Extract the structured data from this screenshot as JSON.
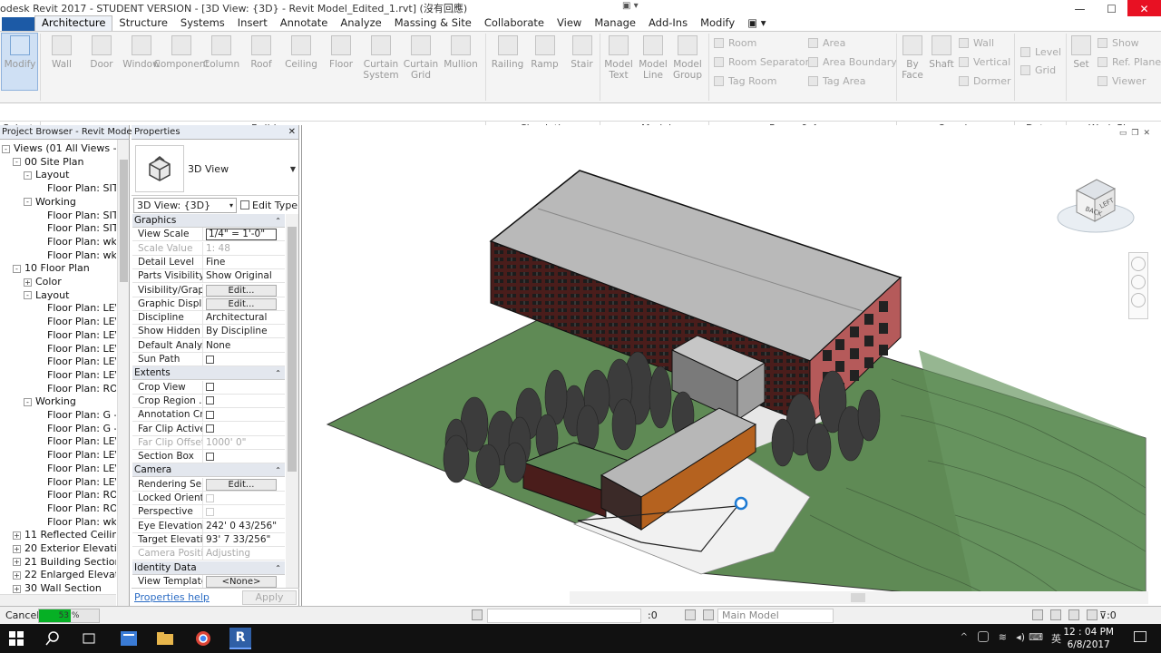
{
  "title": "odesk Revit 2017 - STUDENT VERSION - [3D View: {3D} - Revit Model_Edited_1.rvt] (沒有回應)",
  "tabs": [
    "Architecture",
    "Structure",
    "Systems",
    "Insert",
    "Annotate",
    "Analyze",
    "Massing & Site",
    "Collaborate",
    "View",
    "Manage",
    "Add-Ins",
    "Modify"
  ],
  "ribbon": {
    "modify": "Modify",
    "select": "Select",
    "build_tools": [
      {
        "label": "Wall",
        "icon": "wall-icon"
      },
      {
        "label": "Door",
        "icon": "door-icon"
      },
      {
        "label": "Window",
        "icon": "window-icon"
      },
      {
        "label": "Component",
        "icon": "component-icon"
      },
      {
        "label": "Column",
        "icon": "column-icon"
      },
      {
        "label": "Roof",
        "icon": "roof-icon"
      },
      {
        "label": "Ceiling",
        "icon": "ceiling-icon"
      },
      {
        "label": "Floor",
        "icon": "floor-icon"
      },
      {
        "label": "Curtain System",
        "icon": "curtain-system-icon"
      },
      {
        "label": "Curtain Grid",
        "icon": "curtain-grid-icon"
      },
      {
        "label": "Mullion",
        "icon": "mullion-icon"
      }
    ],
    "circ_tools": [
      {
        "label": "Railing"
      },
      {
        "label": "Ramp"
      },
      {
        "label": "Stair"
      }
    ],
    "model_tools": [
      {
        "label": "Model Text"
      },
      {
        "label": "Model Line"
      },
      {
        "label": "Model Group"
      }
    ],
    "room_small": [
      "Room",
      "Room Separator",
      "Tag Room",
      "Area",
      "Area Boundary",
      "Tag Area"
    ],
    "opening_tools": [
      {
        "label": "By Face"
      },
      {
        "label": "Shaft"
      }
    ],
    "opening_small": [
      "Wall",
      "Vertical",
      "Dormer"
    ],
    "datum_small": [
      "Level",
      "Grid"
    ],
    "wp_tools": [
      {
        "label": "Set"
      }
    ],
    "wp_small": [
      "Show",
      "Ref. Plane",
      "Viewer"
    ],
    "panels": [
      "Build",
      "Circulation",
      "Model",
      "Room & Area",
      "Opening",
      "Datum",
      "Work Plane"
    ]
  },
  "project_browser": {
    "title": "Project Browser - Revit Mode...",
    "items": [
      {
        "label": "Views (01 All Views -",
        "toggle": "-"
      },
      {
        "label": "00 Site Plan",
        "toggle": "-"
      },
      {
        "label": "Layout",
        "toggle": "-"
      },
      {
        "label": "Floor Plan: SITE",
        "toggle": ""
      },
      {
        "label": "Working",
        "toggle": "-"
      },
      {
        "label": "Floor Plan: SITE",
        "toggle": ""
      },
      {
        "label": "Floor Plan: SITE",
        "toggle": ""
      },
      {
        "label": "Floor Plan: wk -",
        "toggle": ""
      },
      {
        "label": "Floor Plan: wk -",
        "toggle": ""
      },
      {
        "label": "10 Floor Plan",
        "toggle": "-"
      },
      {
        "label": "Color",
        "toggle": "+"
      },
      {
        "label": "Layout",
        "toggle": "-"
      },
      {
        "label": "Floor Plan: LEV",
        "toggle": ""
      },
      {
        "label": "Floor Plan: LEV",
        "toggle": ""
      },
      {
        "label": "Floor Plan: LEV",
        "toggle": ""
      },
      {
        "label": "Floor Plan: LEV",
        "toggle": ""
      },
      {
        "label": "Floor Plan: LEV",
        "toggle": ""
      },
      {
        "label": "Floor Plan: LEV",
        "toggle": ""
      },
      {
        "label": "Floor Plan: ROO",
        "toggle": ""
      },
      {
        "label": "Working",
        "toggle": "-"
      },
      {
        "label": "Floor Plan: G -",
        "toggle": ""
      },
      {
        "label": "Floor Plan: G -",
        "toggle": ""
      },
      {
        "label": "Floor Plan: LEV",
        "toggle": ""
      },
      {
        "label": "Floor Plan: LEV",
        "toggle": ""
      },
      {
        "label": "Floor Plan: LEV",
        "toggle": ""
      },
      {
        "label": "Floor Plan: LEV",
        "toggle": ""
      },
      {
        "label": "Floor Plan: ROO",
        "toggle": ""
      },
      {
        "label": "Floor Plan: ROO",
        "toggle": ""
      },
      {
        "label": "Floor Plan: wk -",
        "toggle": ""
      },
      {
        "label": "11 Reflected Ceiling",
        "toggle": "+"
      },
      {
        "label": "20 Exterior Elevation",
        "toggle": "+"
      },
      {
        "label": "21 Building Section",
        "toggle": "+"
      },
      {
        "label": "22 Enlarged Elevation",
        "toggle": "+"
      },
      {
        "label": "30 Wall Section",
        "toggle": "+"
      }
    ]
  },
  "properties": {
    "title": "Properties",
    "type_name": "3D View",
    "instance": "3D View: {3D}",
    "edit_type": "Edit Type",
    "rows": [
      {
        "k": "Graphics",
        "kind": "sec"
      },
      {
        "k": "View Scale",
        "v": "1/4\" = 1'-0\"",
        "kind": "input"
      },
      {
        "k": "Scale Value",
        "v": "1:    48",
        "kind": "dim"
      },
      {
        "k": "Detail Level",
        "v": "Fine"
      },
      {
        "k": "Parts Visibility",
        "v": "Show Original"
      },
      {
        "k": "Visibility/Grap...",
        "v": "Edit...",
        "kind": "btn"
      },
      {
        "k": "Graphic Displ...",
        "v": "Edit...",
        "kind": "btn"
      },
      {
        "k": "Discipline",
        "v": "Architectural"
      },
      {
        "k": "Show Hidden ...",
        "v": "By Discipline"
      },
      {
        "k": "Default Analy...",
        "v": "None"
      },
      {
        "k": "Sun Path",
        "kind": "cb"
      },
      {
        "k": "Extents",
        "kind": "sec"
      },
      {
        "k": "Crop View",
        "kind": "cb"
      },
      {
        "k": "Crop Region ...",
        "kind": "cb"
      },
      {
        "k": "Annotation Cr...",
        "kind": "cb"
      },
      {
        "k": "Far Clip Active",
        "kind": "cb"
      },
      {
        "k": "Far Clip Offset",
        "v": "1000'  0\"",
        "kind": "dim"
      },
      {
        "k": "Section Box",
        "kind": "cb"
      },
      {
        "k": "Camera",
        "kind": "sec"
      },
      {
        "k": "Rendering Se...",
        "v": "Edit...",
        "kind": "btn"
      },
      {
        "k": "Locked Orient...",
        "kind": "cbdim"
      },
      {
        "k": "Perspective",
        "kind": "cbdim"
      },
      {
        "k": "Eye Elevation",
        "v": "242'  0 43/256\""
      },
      {
        "k": "Target Elevati...",
        "v": "93'  7 33/256\""
      },
      {
        "k": "Camera Positi...",
        "v": "Adjusting",
        "kind": "dim"
      },
      {
        "k": "Identity Data",
        "kind": "sec"
      },
      {
        "k": "View Template",
        "v": "<None>",
        "kind": "btn"
      }
    ],
    "help": "Properties help",
    "apply": "Apply"
  },
  "viewcube": {
    "face1": "BACK",
    "face2": "LEFT"
  },
  "status": {
    "cancel": "Cancel",
    "progress": 53,
    "progress_label": "53 %",
    "sel_count": ":0",
    "workset": "Main Model",
    "filter": ":0"
  },
  "taskbar": {
    "time": "12 : 04 PM",
    "date": "6/8/2017"
  },
  "colors": {
    "accent": "#0f4a8a",
    "progress": "#06b025",
    "brick": "#5a2320",
    "grass": "#5f8a55"
  }
}
